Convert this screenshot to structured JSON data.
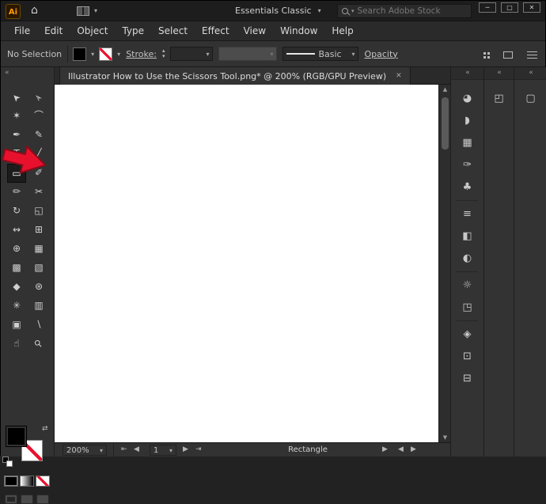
{
  "colors": {
    "arrow_red": "#e8112d",
    "arrow_outline": "#8f0b18",
    "fill_swatch": "#000000"
  },
  "titlebar": {
    "app_badge": "Ai",
    "workspace": "Essentials Classic",
    "search_placeholder": "Search Adobe Stock"
  },
  "menubar": {
    "items": [
      "File",
      "Edit",
      "Object",
      "Type",
      "Select",
      "Effect",
      "View",
      "Window",
      "Help"
    ]
  },
  "controlbar": {
    "selection_status": "No Selection",
    "stroke_label": "Stroke:",
    "brush_value": "Basic",
    "opacity_label": "Opacity"
  },
  "tabbar": {
    "title": "Illustrator How to Use the Scissors Tool.png* @ 200% (RGB/GPU Preview)"
  },
  "toolbar": {
    "tools": [
      {
        "name": "selection-tool",
        "glyph": "➤"
      },
      {
        "name": "direct-selection-tool",
        "glyph": "➢"
      },
      {
        "name": "magic-wand-tool",
        "glyph": "✶"
      },
      {
        "name": "lasso-tool",
        "glyph": "⌒"
      },
      {
        "name": "pen-tool",
        "glyph": "✒"
      },
      {
        "name": "curvature-tool",
        "glyph": "✎"
      },
      {
        "name": "type-tool",
        "glyph": "T"
      },
      {
        "name": "line-segment-tool",
        "glyph": "╱"
      },
      {
        "name": "rectangle-tool",
        "glyph": "▭",
        "selected": true
      },
      {
        "name": "paintbrush-tool",
        "glyph": "✐"
      },
      {
        "name": "pencil-tool",
        "glyph": "✏"
      },
      {
        "name": "scissors-tool",
        "glyph": "✂"
      },
      {
        "name": "rotate-tool",
        "glyph": "↻"
      },
      {
        "name": "scale-tool",
        "glyph": "◱"
      },
      {
        "name": "width-tool",
        "glyph": "↭"
      },
      {
        "name": "free-transform-tool",
        "glyph": "⊞"
      },
      {
        "name": "shape-builder-tool",
        "glyph": "⊕"
      },
      {
        "name": "perspective-grid-tool",
        "glyph": "▦"
      },
      {
        "name": "mesh-tool",
        "glyph": "▩"
      },
      {
        "name": "gradient-tool",
        "glyph": "▧"
      },
      {
        "name": "eyedropper-tool",
        "glyph": "◆"
      },
      {
        "name": "blend-tool",
        "glyph": "⊛"
      },
      {
        "name": "symbol-sprayer-tool",
        "glyph": "✳"
      },
      {
        "name": "column-graph-tool",
        "glyph": "▥"
      },
      {
        "name": "artboard-tool",
        "glyph": "▣"
      },
      {
        "name": "slice-tool",
        "glyph": "∖"
      },
      {
        "name": "hand-tool",
        "glyph": "☝"
      },
      {
        "name": "zoom-tool",
        "glyph": "⚲"
      }
    ]
  },
  "docks": {
    "collapse_glyph": "«",
    "panels": [
      {
        "name": "color-panel",
        "glyph": "◕"
      },
      {
        "name": "color-guide-panel",
        "glyph": "◗"
      },
      {
        "name": "swatches-panel",
        "glyph": "▦"
      },
      {
        "name": "brushes-panel",
        "glyph": "✑"
      },
      {
        "name": "symbols-panel",
        "glyph": "♣"
      },
      {
        "name": "stroke-panel",
        "glyph": "≡"
      },
      {
        "name": "gradient-panel",
        "glyph": "◧"
      },
      {
        "name": "transparency-panel",
        "glyph": "◐"
      },
      {
        "name": "appearance-panel",
        "glyph": "☼"
      },
      {
        "name": "graphic-styles-panel",
        "glyph": "◳"
      },
      {
        "name": "layers-panel",
        "glyph": "◈"
      },
      {
        "name": "artboards-panel",
        "glyph": "⊡"
      },
      {
        "name": "asset-export-panel",
        "glyph": "⊟"
      }
    ],
    "dock2_icon": {
      "name": "libraries-panel",
      "glyph": "◰"
    },
    "dock3_icon": {
      "name": "properties-panel",
      "glyph": "▢"
    }
  },
  "statusbar": {
    "zoom": "200%",
    "artboard": "1",
    "status": "Rectangle"
  },
  "icons": {
    "home": "⌂",
    "chevron": "▾",
    "minimize": "─",
    "maximize": "□",
    "close": "✕",
    "collapse": "«",
    "swap": "⇄",
    "up": "▲",
    "down": "▼",
    "left": "◀",
    "right": "▶",
    "first": "⇤",
    "last": "⇥",
    "stepper_up": "▴",
    "stepper_down": "▾",
    "flyout": "▶"
  }
}
